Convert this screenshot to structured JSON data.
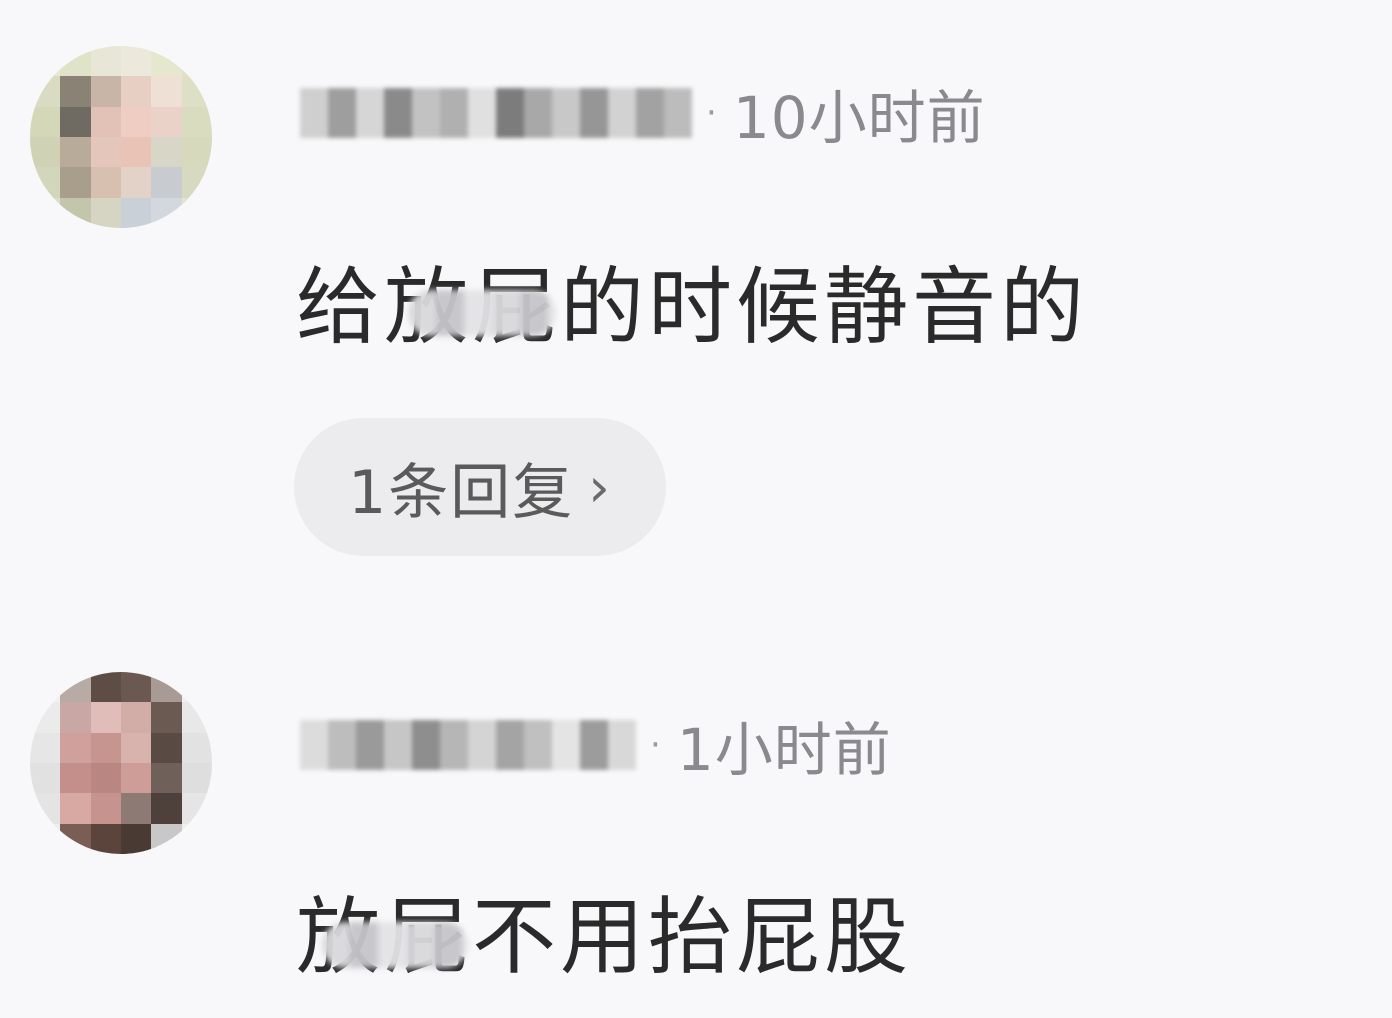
{
  "comments": [
    {
      "time": "10小时前",
      "separator": "·",
      "text": "给放屁的时候静音的",
      "replies_label": "1条回复",
      "chevron": "›",
      "avatar_icon": "blurred-avatar-icon"
    },
    {
      "time": "1小时前",
      "separator": "·",
      "text": "放屁不用抬屁股",
      "avatar_icon": "blurred-avatar-icon"
    }
  ]
}
